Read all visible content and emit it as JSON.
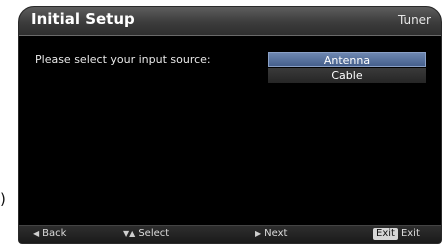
{
  "page": {
    "side_glyph": ")"
  },
  "header": {
    "title": "Initial Setup",
    "tab": "Tuner"
  },
  "prompt": "Please select your input source:",
  "options": [
    {
      "label": "Antenna",
      "selected": true
    },
    {
      "label": "Cable",
      "selected": false
    }
  ],
  "footer": {
    "back": {
      "icon": "left-arrow-icon",
      "label": "Back"
    },
    "select": {
      "icon": "up-down-arrows-icon",
      "label": "Select"
    },
    "next": {
      "icon": "right-arrow-icon",
      "label": "Next"
    },
    "exit": {
      "badge": "Exit",
      "label": "Exit"
    }
  },
  "colors": {
    "selected_option": "#5a73a0",
    "background": "#000000"
  }
}
